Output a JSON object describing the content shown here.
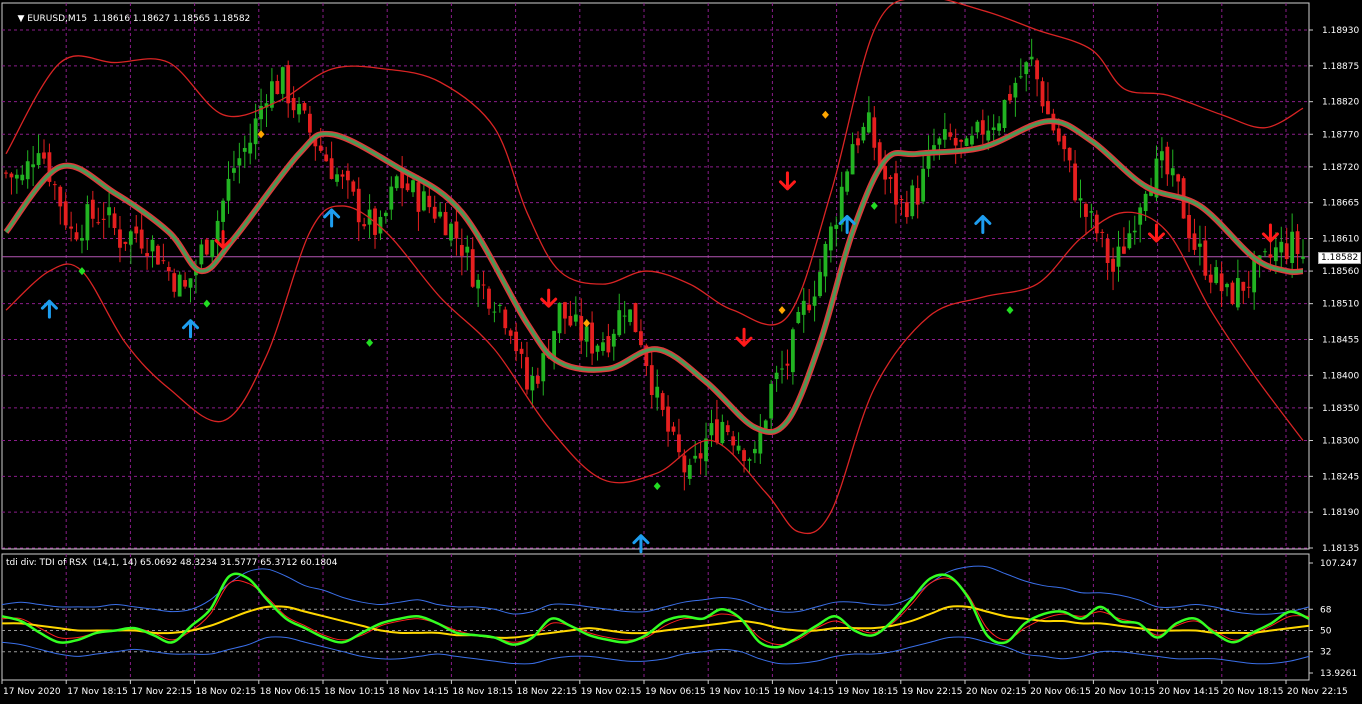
{
  "header": {
    "symbol": "EURUSD,M15",
    "ohlc": "1.18616 1.18627 1.18565 1.18582"
  },
  "indicator": {
    "title": "tdi div: TDI of RSX  (14,1, 14) 65.0692 48.3234 31.5777 65.3712 60.1804",
    "levels": [
      "107.247",
      "68",
      "50",
      "32",
      "13.9261"
    ]
  },
  "colors": {
    "grid": "#8a1c8a",
    "bull": "#22b322",
    "bear": "#e51f1f",
    "band": "#d92424",
    "ma_outer": "#e03a3a",
    "ma_inner": "#4a9a55",
    "arrow_up": "#1e9ef0",
    "arrow_down": "#ff1a1a",
    "dot_green": "#22dd22",
    "dot_orange": "#ffa500",
    "tdi_green": "#33ff22",
    "tdi_yellow": "#ffd700",
    "tdi_red": "#ff2020",
    "tdi_blue": "#3a6fe8"
  },
  "chart_data": {
    "type": "candlestick",
    "symbol": "EURUSD",
    "timeframe": "M15",
    "current_price": "1.18582",
    "price_ticks": [
      "1.18930",
      "1.18875",
      "1.18820",
      "1.18770",
      "1.18720",
      "1.18665",
      "1.18610",
      "1.18560",
      "1.18510",
      "1.18455",
      "1.18400",
      "1.18350",
      "1.18300",
      "1.18245",
      "1.18190",
      "1.18135"
    ],
    "x_ticks": [
      "17 Nov 2020",
      "17 Nov 18:15",
      "17 Nov 22:15",
      "18 Nov 02:15",
      "18 Nov 06:15",
      "18 Nov 10:15",
      "18 Nov 14:15",
      "18 Nov 18:15",
      "18 Nov 22:15",
      "19 Nov 02:15",
      "19 Nov 06:15",
      "19 Nov 10:15",
      "19 Nov 14:15",
      "19 Nov 18:15",
      "19 Nov 22:15",
      "20 Nov 02:15",
      "20 Nov 06:15",
      "20 Nov 10:15",
      "20 Nov 14:15",
      "20 Nov 18:15",
      "20 Nov 22:15"
    ],
    "close_path": [
      [
        0,
        1.1871
      ],
      [
        3,
        1.187
      ],
      [
        6,
        1.1876
      ],
      [
        9,
        1.1869
      ],
      [
        12,
        1.1862
      ],
      [
        15,
        1.1864
      ],
      [
        18,
        1.1865
      ],
      [
        21,
        1.1861
      ],
      [
        24,
        1.1862
      ],
      [
        27,
        1.186
      ],
      [
        30,
        1.1856
      ],
      [
        33,
        1.1853
      ],
      [
        36,
        1.1859
      ],
      [
        39,
        1.1864
      ],
      [
        42,
        1.1872
      ],
      [
        45,
        1.1876
      ],
      [
        48,
        1.1884
      ],
      [
        51,
        1.1885
      ],
      [
        54,
        1.188
      ],
      [
        57,
        1.1876
      ],
      [
        60,
        1.1872
      ],
      [
        63,
        1.1868
      ],
      [
        66,
        1.1864
      ],
      [
        69,
        1.1862
      ],
      [
        72,
        1.187
      ],
      [
        75,
        1.1868
      ],
      [
        78,
        1.1866
      ],
      [
        81,
        1.1864
      ],
      [
        84,
        1.186
      ],
      [
        87,
        1.1854
      ],
      [
        90,
        1.1852
      ],
      [
        93,
        1.1848
      ],
      [
        96,
        1.1838
      ],
      [
        99,
        1.1842
      ],
      [
        102,
        1.185
      ],
      [
        105,
        1.1847
      ],
      [
        108,
        1.1845
      ],
      [
        111,
        1.1846
      ],
      [
        114,
        1.1851
      ],
      [
        117,
        1.1846
      ],
      [
        120,
        1.1836
      ],
      [
        123,
        1.1829
      ],
      [
        126,
        1.1824
      ],
      [
        129,
        1.183
      ],
      [
        132,
        1.1833
      ],
      [
        135,
        1.183
      ],
      [
        138,
        1.1827
      ],
      [
        141,
        1.1838
      ],
      [
        144,
        1.1842
      ],
      [
        147,
        1.185
      ],
      [
        150,
        1.1856
      ],
      [
        153,
        1.1865
      ],
      [
        156,
        1.1876
      ],
      [
        159,
        1.1878
      ],
      [
        162,
        1.187
      ],
      [
        165,
        1.1866
      ],
      [
        168,
        1.1868
      ],
      [
        171,
        1.1875
      ],
      [
        174,
        1.1876
      ],
      [
        177,
        1.1874
      ],
      [
        180,
        1.1878
      ],
      [
        183,
        1.188
      ],
      [
        186,
        1.1885
      ],
      [
        189,
        1.1888
      ],
      [
        192,
        1.188
      ],
      [
        195,
        1.1874
      ],
      [
        198,
        1.1866
      ],
      [
        201,
        1.1862
      ],
      [
        204,
        1.1856
      ],
      [
        207,
        1.1862
      ],
      [
        210,
        1.187
      ],
      [
        213,
        1.1872
      ],
      [
        216,
        1.1868
      ],
      [
        219,
        1.186
      ],
      [
        222,
        1.1856
      ],
      [
        225,
        1.1852
      ],
      [
        228,
        1.1854
      ],
      [
        231,
        1.1856
      ],
      [
        234,
        1.1859
      ],
      [
        237,
        1.186
      ],
      [
        239,
        1.18582
      ]
    ],
    "ma_path": [
      [
        0,
        1.1862
      ],
      [
        10,
        1.1872
      ],
      [
        20,
        1.1868
      ],
      [
        30,
        1.1862
      ],
      [
        36,
        1.1856
      ],
      [
        42,
        1.1861
      ],
      [
        54,
        1.1874
      ],
      [
        60,
        1.1877
      ],
      [
        72,
        1.1872
      ],
      [
        84,
        1.1865
      ],
      [
        96,
        1.1848
      ],
      [
        102,
        1.1842
      ],
      [
        111,
        1.1841
      ],
      [
        120,
        1.1844
      ],
      [
        129,
        1.1839
      ],
      [
        138,
        1.1832
      ],
      [
        144,
        1.1833
      ],
      [
        150,
        1.1845
      ],
      [
        156,
        1.1862
      ],
      [
        162,
        1.1873
      ],
      [
        168,
        1.1874
      ],
      [
        180,
        1.1875
      ],
      [
        192,
        1.1879
      ],
      [
        200,
        1.1876
      ],
      [
        210,
        1.1869
      ],
      [
        220,
        1.1866
      ],
      [
        230,
        1.1858
      ],
      [
        236,
        1.1856
      ],
      [
        239,
        1.1856
      ]
    ],
    "upper_band": [
      [
        0,
        1.1874
      ],
      [
        10,
        1.1888
      ],
      [
        20,
        1.1888
      ],
      [
        30,
        1.1888
      ],
      [
        40,
        1.188
      ],
      [
        50,
        1.1882
      ],
      [
        60,
        1.1887
      ],
      [
        70,
        1.1887
      ],
      [
        80,
        1.1885
      ],
      [
        90,
        1.1878
      ],
      [
        96,
        1.1865
      ],
      [
        102,
        1.1856
      ],
      [
        110,
        1.1854
      ],
      [
        118,
        1.1856
      ],
      [
        126,
        1.1854
      ],
      [
        134,
        1.185
      ],
      [
        144,
        1.1849
      ],
      [
        152,
        1.1868
      ],
      [
        160,
        1.1893
      ],
      [
        168,
        1.1898
      ],
      [
        180,
        1.1896
      ],
      [
        190,
        1.1893
      ],
      [
        200,
        1.189
      ],
      [
        206,
        1.1884
      ],
      [
        214,
        1.1883
      ],
      [
        224,
        1.188
      ],
      [
        232,
        1.1878
      ],
      [
        239,
        1.1881
      ]
    ],
    "lower_band": [
      [
        0,
        1.185
      ],
      [
        8,
        1.1856
      ],
      [
        14,
        1.1856
      ],
      [
        22,
        1.1845
      ],
      [
        30,
        1.1838
      ],
      [
        40,
        1.1833
      ],
      [
        48,
        1.1843
      ],
      [
        56,
        1.1862
      ],
      [
        62,
        1.1866
      ],
      [
        70,
        1.1862
      ],
      [
        80,
        1.1852
      ],
      [
        90,
        1.1844
      ],
      [
        100,
        1.1832
      ],
      [
        110,
        1.1824
      ],
      [
        120,
        1.1825
      ],
      [
        130,
        1.183
      ],
      [
        140,
        1.1822
      ],
      [
        146,
        1.1816
      ],
      [
        152,
        1.1819
      ],
      [
        160,
        1.1838
      ],
      [
        170,
        1.1849
      ],
      [
        180,
        1.1852
      ],
      [
        190,
        1.1854
      ],
      [
        198,
        1.1861
      ],
      [
        206,
        1.1865
      ],
      [
        214,
        1.1862
      ],
      [
        222,
        1.185
      ],
      [
        230,
        1.184
      ],
      [
        239,
        1.183
      ]
    ],
    "signals_up": [
      [
        8,
        1.185
      ],
      [
        34,
        1.1847
      ],
      [
        60,
        1.1864
      ],
      [
        117,
        1.1814
      ],
      [
        155,
        1.1863
      ],
      [
        180,
        1.1863
      ]
    ],
    "signals_down": [
      [
        40,
        1.1861
      ],
      [
        100,
        1.1852
      ],
      [
        136,
        1.1846
      ],
      [
        144,
        1.187
      ],
      [
        212,
        1.1862
      ],
      [
        233,
        1.1862
      ]
    ],
    "dots_green": [
      [
        14,
        1.1856
      ],
      [
        37,
        1.1851
      ],
      [
        67,
        1.1845
      ],
      [
        120,
        1.1823
      ],
      [
        160,
        1.1866
      ],
      [
        185,
        1.185
      ]
    ],
    "dots_orange": [
      [
        47,
        1.1877
      ],
      [
        107,
        1.1848
      ],
      [
        143,
        1.185
      ],
      [
        151,
        1.188
      ]
    ],
    "tdi_series": [
      {
        "color": "tdi_green",
        "values": [
          62,
          58,
          48,
          40,
          42,
          48,
          50,
          52,
          46,
          40,
          54,
          68,
          96,
          94,
          76,
          60,
          52,
          44,
          40,
          48,
          56,
          60,
          62,
          56,
          48,
          46,
          44,
          38,
          44,
          60,
          54,
          46,
          42,
          40,
          46,
          58,
          62,
          60,
          68,
          60,
          40,
          36,
          44,
          54,
          62,
          50,
          46,
          58,
          76,
          94,
          96,
          78,
          46,
          40,
          56,
          64,
          66,
          60,
          70,
          58,
          56,
          44,
          56,
          60,
          48,
          40,
          48,
          56,
          66,
          60
        ]
      },
      {
        "color": "tdi_red",
        "values": [
          60,
          60,
          52,
          44,
          44,
          48,
          50,
          52,
          48,
          42,
          50,
          64,
          90,
          90,
          78,
          62,
          54,
          46,
          42,
          46,
          54,
          58,
          60,
          56,
          50,
          46,
          44,
          40,
          44,
          56,
          54,
          48,
          44,
          42,
          44,
          54,
          60,
          60,
          64,
          60,
          44,
          38,
          42,
          52,
          58,
          52,
          48,
          56,
          72,
          90,
          94,
          80,
          52,
          42,
          52,
          60,
          64,
          62,
          66,
          60,
          56,
          46,
          54,
          58,
          50,
          42,
          46,
          54,
          62,
          62
        ]
      },
      {
        "color": "tdi_yellow",
        "values": [
          56,
          56,
          54,
          52,
          50,
          50,
          50,
          50,
          48,
          48,
          50,
          54,
          60,
          66,
          70,
          70,
          66,
          62,
          58,
          54,
          50,
          48,
          48,
          48,
          46,
          46,
          44,
          44,
          46,
          48,
          50,
          52,
          50,
          48,
          48,
          50,
          52,
          54,
          56,
          58,
          56,
          52,
          50,
          50,
          52,
          52,
          52,
          54,
          58,
          64,
          70,
          70,
          66,
          62,
          60,
          58,
          58,
          56,
          56,
          54,
          52,
          50,
          50,
          50,
          48,
          48,
          48,
          50,
          52,
          54
        ]
      },
      {
        "color": "tdi_blue",
        "values": [
          72,
          74,
          72,
          70,
          70,
          70,
          72,
          70,
          68,
          66,
          68,
          76,
          90,
          100,
          102,
          96,
          88,
          84,
          78,
          74,
          72,
          74,
          76,
          72,
          70,
          70,
          68,
          64,
          66,
          72,
          72,
          70,
          68,
          66,
          66,
          70,
          74,
          76,
          78,
          76,
          70,
          66,
          66,
          70,
          74,
          74,
          72,
          72,
          78,
          90,
          100,
          104,
          104,
          98,
          92,
          88,
          86,
          82,
          82,
          80,
          76,
          70,
          70,
          72,
          70,
          66,
          64,
          64,
          66,
          70
        ]
      },
      {
        "color": "tdi_blue",
        "values": [
          40,
          38,
          34,
          30,
          28,
          30,
          32,
          34,
          32,
          30,
          30,
          30,
          34,
          38,
          44,
          44,
          40,
          36,
          32,
          28,
          26,
          26,
          28,
          30,
          28,
          26,
          24,
          22,
          22,
          26,
          28,
          28,
          26,
          24,
          24,
          26,
          30,
          32,
          34,
          32,
          26,
          22,
          22,
          24,
          28,
          30,
          30,
          32,
          36,
          40,
          44,
          44,
          40,
          36,
          30,
          28,
          26,
          28,
          32,
          32,
          30,
          28,
          26,
          26,
          26,
          24,
          22,
          22,
          24,
          28
        ]
      }
    ]
  }
}
